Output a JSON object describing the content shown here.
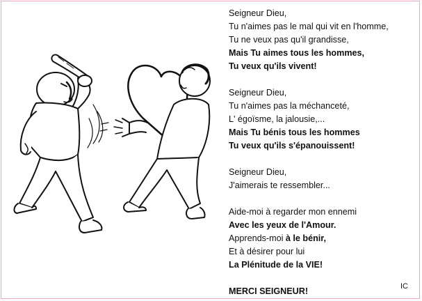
{
  "poem": {
    "stanza1": {
      "l1": "Seigneur Dieu,",
      "l2": "Tu n'aimes pas le mal qui vit en l'homme,",
      "l3": "Tu ne veux pas qu'il grandisse,",
      "l4": "Mais Tu aimes tous les hommes,",
      "l5": "Tu veux qu'ils vivent!"
    },
    "stanza2": {
      "l1": "Seigneur  Dieu,",
      "l2": "Tu n'aimes pas la méchanceté,",
      "l3": "L' égoïsme, la jalousie,...",
      "l4": "Mais Tu bénis tous les hommes",
      "l5": "Tu veux qu'ils s'épanouissent!"
    },
    "stanza3": {
      "l1": "Seigneur Dieu,",
      "l2": "J'aimerais te ressembler..."
    },
    "stanza4": {
      "l1": "Aide-moi à regarder mon ennemi",
      "l2": "Avec les yeux de l'Amour.",
      "l3_normal": "Apprends-moi ",
      "l3_bold": "à le bénir,",
      "l4": "Et à désirer pour lui",
      "l5": "La Plénitude de la VIE!"
    },
    "closing": "MERCI SEIGNEUR!"
  },
  "initials": "IC",
  "colors": {
    "frame_border": "#f0a6c2",
    "ink": "#111111",
    "background": "#ffffff"
  }
}
